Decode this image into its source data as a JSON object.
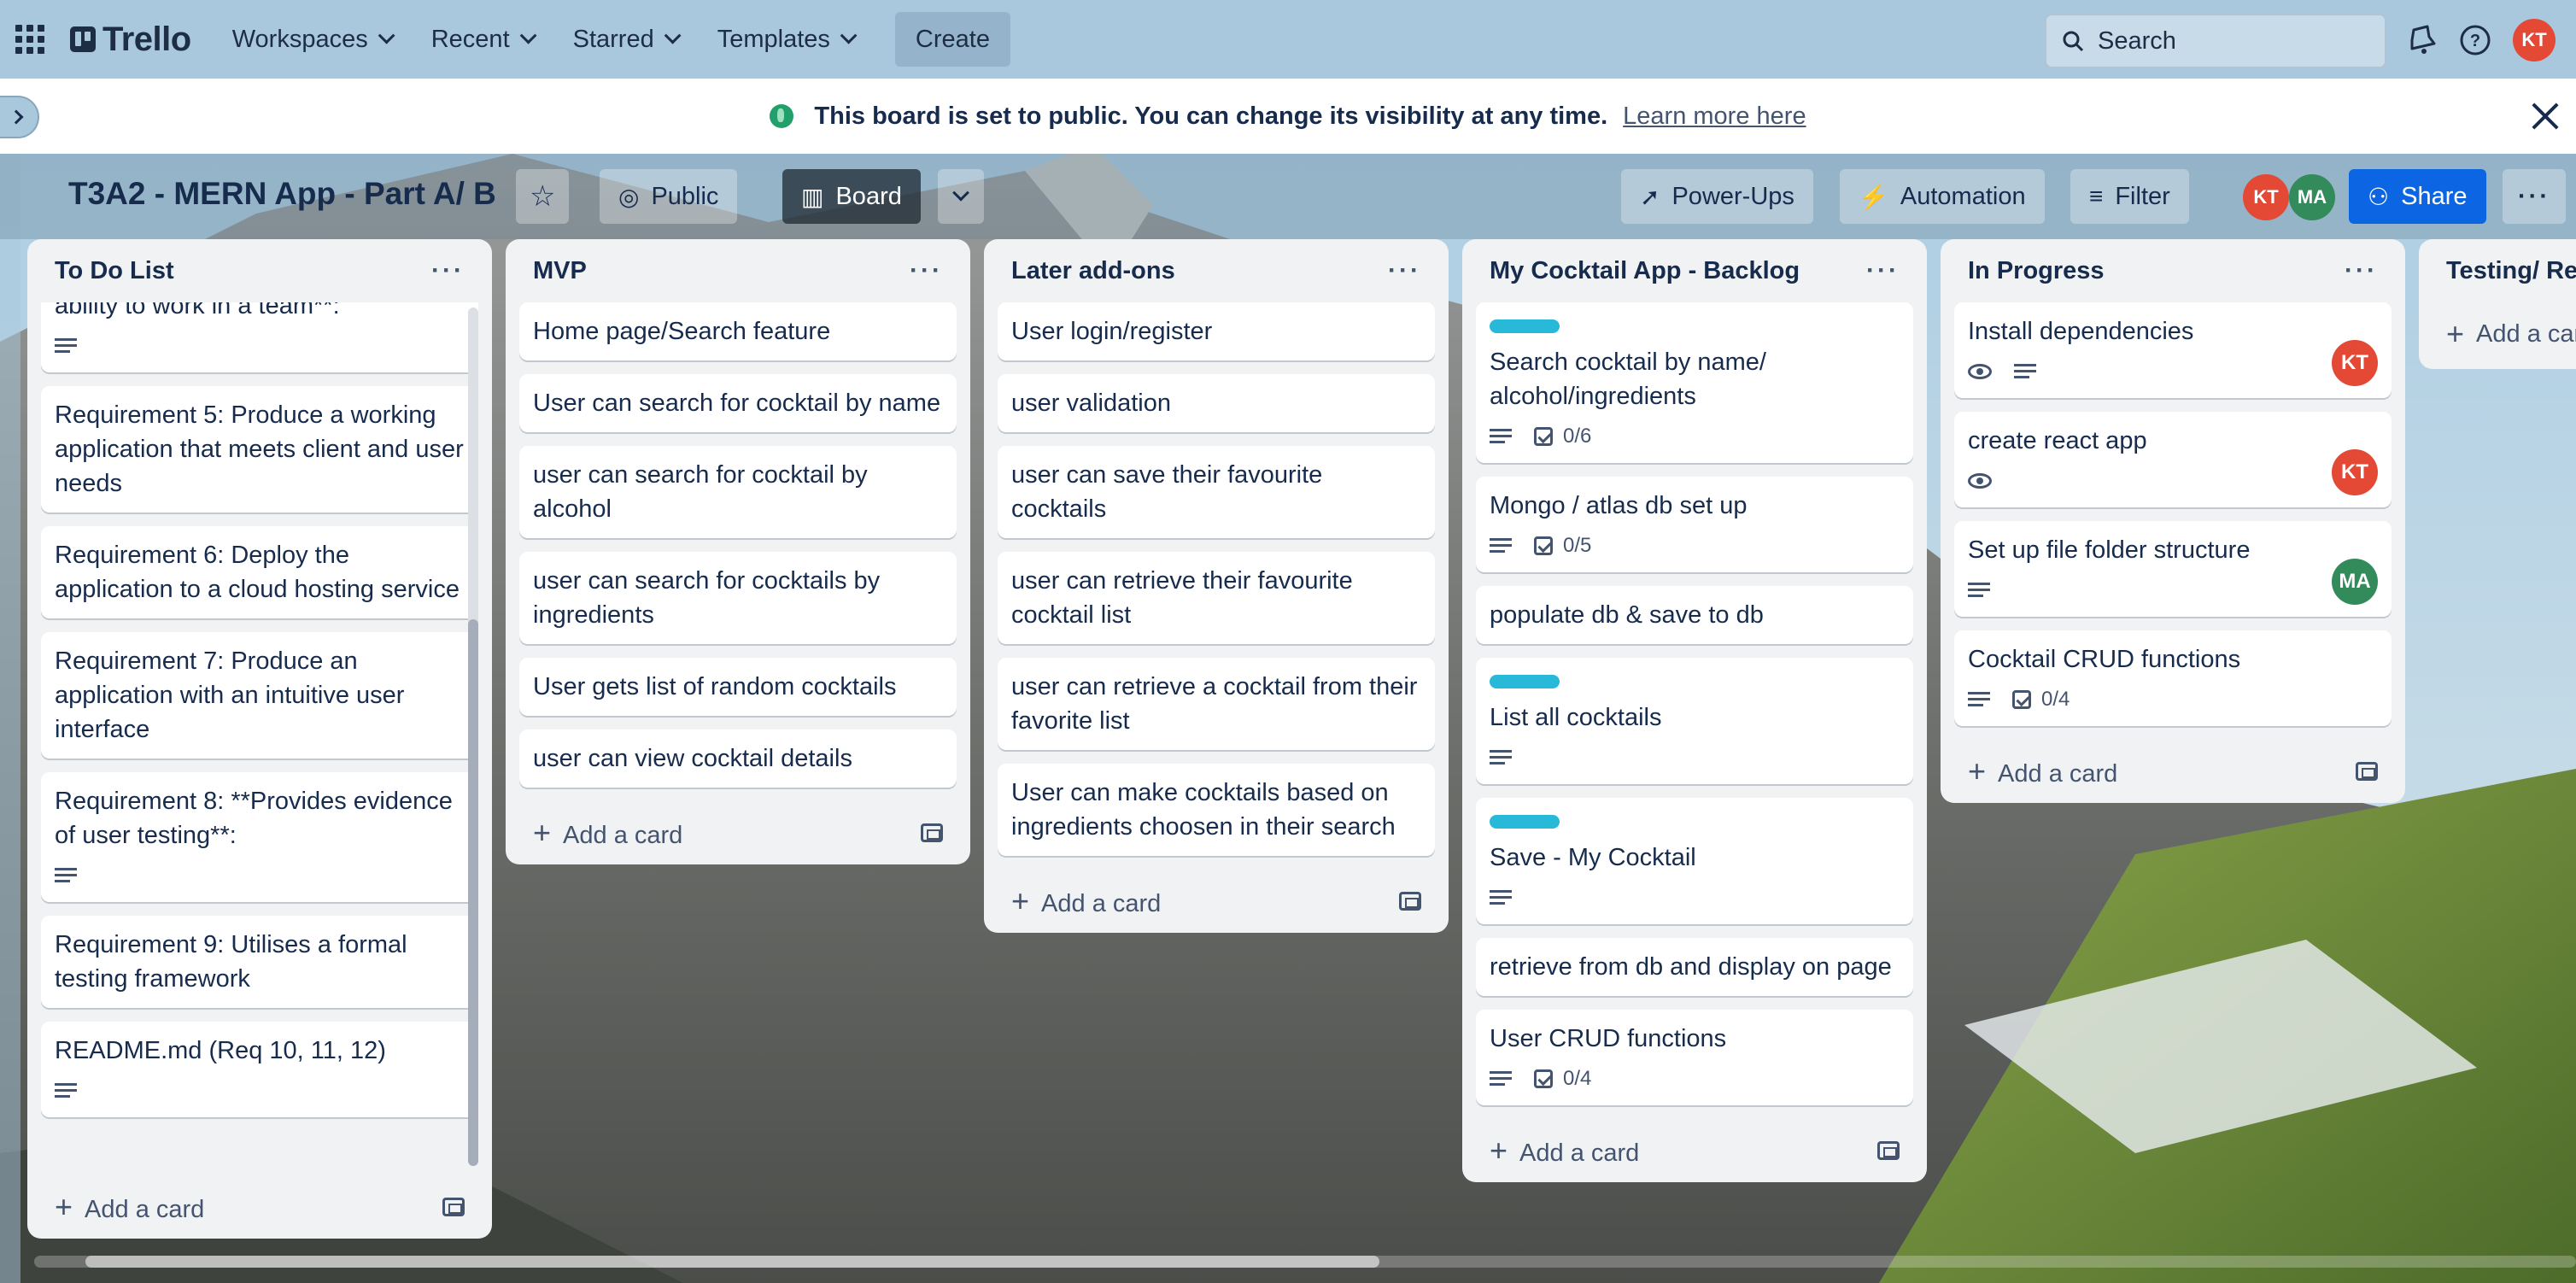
{
  "topbar": {
    "logo": "Trello",
    "nav": [
      "Workspaces",
      "Recent",
      "Starred",
      "Templates"
    ],
    "create": "Create",
    "search_placeholder": "Search",
    "user_initials": "KT"
  },
  "banner": {
    "message": "This board is set to public. You can change its visibility at any time.",
    "link": "Learn more here"
  },
  "board": {
    "title": "T3A2 - MERN App - Part A/ B",
    "visibility": "Public",
    "view": "Board",
    "powerups": "Power-Ups",
    "automation": "Automation",
    "filter": "Filter",
    "members": [
      "KT",
      "MA"
    ],
    "share": "Share"
  },
  "lists": {
    "todo": {
      "title": "To Do List",
      "cards": [
        "ability to work in a team**:",
        "Requirement 5: Produce a working application that meets client and user needs",
        "Requirement 6: Deploy the application to a cloud hosting service",
        "Requirement 7: Produce an application with an intuitive user interface",
        "Requirement 8: **Provides evidence of user testing**:",
        "Requirement 9: Utilises a formal testing framework",
        "README.md (Req 10, 11, 12)"
      ],
      "add": "Add a card"
    },
    "mvp": {
      "title": "MVP",
      "cards": [
        "Home page/Search feature",
        "User can search for cocktail by name",
        "user can search for cocktail by alcohol",
        "user can search for cocktails by ingredients",
        "User gets list of random cocktails",
        "user can view cocktail details"
      ],
      "add": "Add a card"
    },
    "later": {
      "title": "Later add-ons",
      "cards": [
        "User login/register",
        "user validation",
        "user can save their favourite cocktails",
        "user can retrieve their favourite cocktail list",
        "user can retrieve a cocktail from their favorite list",
        "User can make cocktails based on ingredients choosen in their search"
      ],
      "add": "Add a card"
    },
    "backlog": {
      "title": "My Cocktail App - Backlog",
      "cards": [
        "Search cocktail by name/ alcohol/ingredients",
        "Mongo / atlas db set up",
        "populate db & save to db",
        "List all cocktails",
        "Save - My Cocktail",
        "retrieve from db and display on page",
        "User CRUD functions"
      ],
      "checks": [
        "0/6",
        "0/5",
        "0/4"
      ],
      "add": "Add a card"
    },
    "progress": {
      "title": "In Progress",
      "cards": [
        "Install dependencies",
        "create react app",
        "Set up file folder structure",
        "Cocktail CRUD functions"
      ],
      "avatars": [
        "KT",
        "KT",
        "MA"
      ],
      "checks": [
        "0/4"
      ],
      "add": "Add a card"
    },
    "testing": {
      "title": "Testing/ Rev",
      "add": "Add a card"
    }
  },
  "colors": {
    "label": "#29b9d8",
    "avatar_kt": "#e34935",
    "avatar_ma": "#338a5a",
    "share": "#0c66e4"
  }
}
